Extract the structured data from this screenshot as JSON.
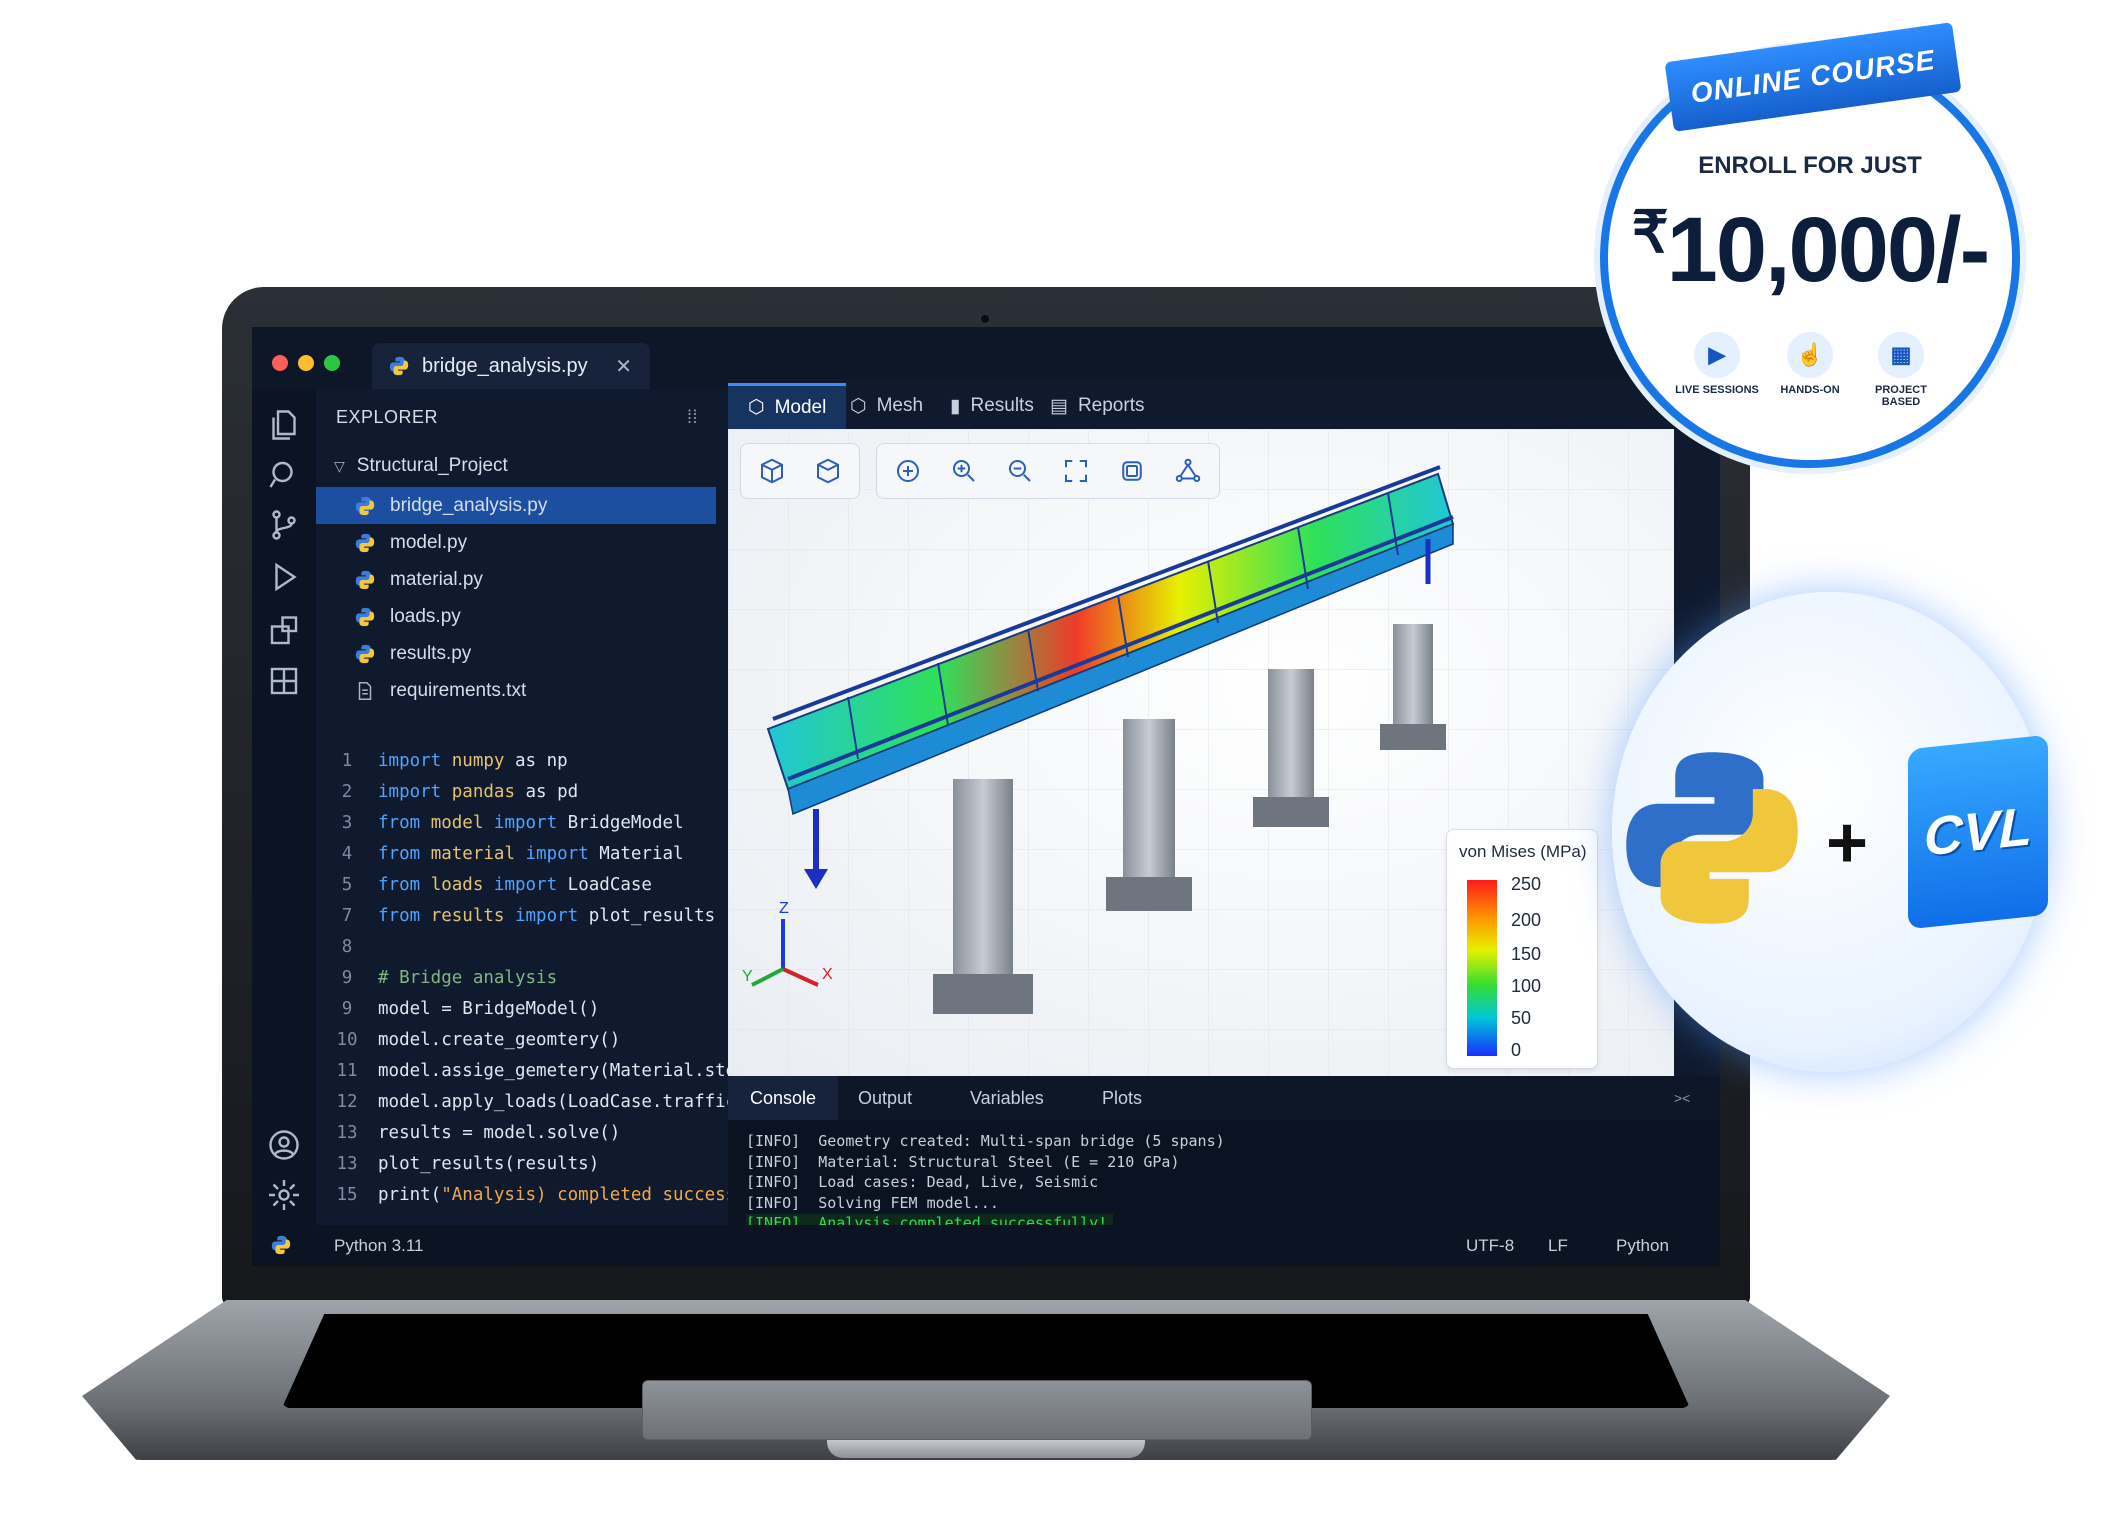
{
  "badge": {
    "ribbon": "ONLINE COURSE",
    "enroll": "ENROLL FOR JUST",
    "currency": "₹",
    "price": "10,000/-",
    "features": [
      {
        "label": "LIVE SESSIONS",
        "icon": "video-icon"
      },
      {
        "label": "HANDS-ON",
        "icon": "hands-on-icon"
      },
      {
        "label": "PROJECT BASED",
        "icon": "blueprint-icon"
      }
    ]
  },
  "combo": {
    "plus": "+",
    "cvl_label": "CVL"
  },
  "ide": {
    "file_tab": "bridge_analysis.py",
    "explorer": {
      "title": "EXPLORER",
      "folder": "Structural_Project",
      "files": [
        "bridge_analysis.py",
        "model.py",
        "material.py",
        "loads.py",
        "results.py",
        "requirements.txt"
      ]
    },
    "code": [
      {
        "n": "1",
        "parts": [
          [
            "kw",
            "import "
          ],
          [
            "mod",
            "numpy"
          ],
          [
            "t",
            " as np"
          ]
        ]
      },
      {
        "n": "2",
        "parts": [
          [
            "kw",
            "import "
          ],
          [
            "mod",
            "pandas"
          ],
          [
            "t",
            " as pd"
          ]
        ]
      },
      {
        "n": "3",
        "parts": [
          [
            "kw",
            "from "
          ],
          [
            "mod",
            "model"
          ],
          [
            "kw",
            " import "
          ],
          [
            "t",
            "BridgeModel"
          ]
        ]
      },
      {
        "n": "4",
        "parts": [
          [
            "kw",
            "from "
          ],
          [
            "mod",
            "material"
          ],
          [
            "kw",
            " import "
          ],
          [
            "t",
            "Material"
          ]
        ]
      },
      {
        "n": "5",
        "parts": [
          [
            "kw",
            "from "
          ],
          [
            "mod",
            "loads"
          ],
          [
            "kw",
            " import "
          ],
          [
            "t",
            "LoadCase"
          ]
        ]
      },
      {
        "n": "7",
        "parts": [
          [
            "kw",
            "from "
          ],
          [
            "mod",
            "results"
          ],
          [
            "kw",
            " import "
          ],
          [
            "t",
            "plot_results"
          ]
        ]
      },
      {
        "n": "8",
        "parts": []
      },
      {
        "n": "9",
        "parts": [
          [
            "cm",
            "# Bridge analysis"
          ]
        ]
      },
      {
        "n": "9",
        "parts": [
          [
            "t",
            "model = BridgeModel()"
          ]
        ]
      },
      {
        "n": "10",
        "parts": [
          [
            "t",
            "model.create_geomtery()"
          ]
        ]
      },
      {
        "n": "11",
        "parts": [
          [
            "t",
            "model.assige_gemetery(Material.steel)"
          ]
        ]
      },
      {
        "n": "12",
        "parts": [
          [
            "t",
            "model.apply_loads(LoadCase.traffic)"
          ]
        ]
      },
      {
        "n": "13",
        "parts": [
          [
            "t",
            "results = model.solve()"
          ]
        ]
      },
      {
        "n": "13",
        "parts": [
          [
            "t",
            "plot_results(results)"
          ]
        ]
      },
      {
        "n": "15",
        "parts": [
          [
            "t",
            "print("
          ],
          [
            "st",
            "\"Analysis) completed successfuly!\""
          ],
          [
            "t",
            ")"
          ]
        ]
      }
    ],
    "view_tabs": [
      "Model",
      "Mesh",
      "Results",
      "Reports"
    ],
    "legend": {
      "title": "von Mises (MPa)",
      "values": [
        "250",
        "200",
        "150",
        "100",
        "50",
        "0"
      ]
    },
    "axes": {
      "x": "X",
      "y": "Y",
      "z": "Z"
    },
    "bottom_tabs": [
      "Console",
      "Output",
      "Variables",
      "Plots"
    ],
    "console": [
      "[INFO]  Geometry created: Multi-span bridge (5 spans)",
      "[INFO]  Material: Structural Steel (E = 210 GPa)",
      "[INFO]  Load cases: Dead, Live, Seismic",
      "[INFO]  Solving FEM model...",
      "[INFO]  Analysis completed successfully!"
    ],
    "status": {
      "python": "Python 3.11",
      "encoding": "UTF-8",
      "eol": "LF",
      "language": "Python"
    }
  },
  "colors": {
    "accent": "#1877e6",
    "selection": "#1c4fa0",
    "success": "#29e04a"
  }
}
